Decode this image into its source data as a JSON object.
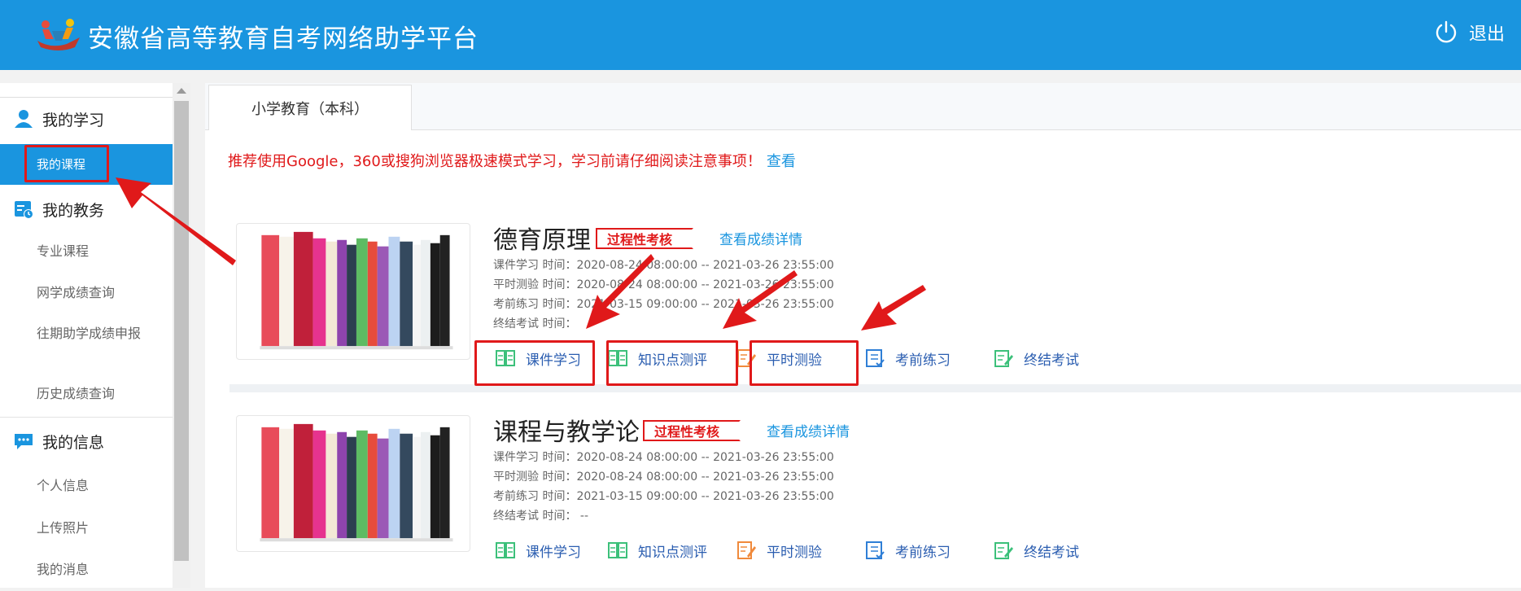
{
  "header": {
    "title": "安徽省高等教育自考网络助学平台",
    "logout": "退出"
  },
  "sidebar": {
    "study": {
      "label": "我的学习",
      "items": [
        {
          "label": "我的课程"
        }
      ]
    },
    "affairs": {
      "label": "我的教务",
      "items": [
        {
          "label": "专业课程"
        },
        {
          "label": "网学成绩查询"
        },
        {
          "label": "往期助学成绩申报"
        },
        {
          "label": "历史成绩查询"
        }
      ]
    },
    "info": {
      "label": "我的信息",
      "items": [
        {
          "label": "个人信息"
        },
        {
          "label": "上传照片"
        },
        {
          "label": "我的消息"
        }
      ]
    }
  },
  "main": {
    "tab": "小学教育（本科）",
    "notice": "推荐使用Google，360或搜狗浏览器极速模式学习，学习前请仔细阅读注意事项！",
    "notice_link": "查看",
    "courses": [
      {
        "title": "德育原理",
        "badge": "过程性考核",
        "detail": "查看成绩详情",
        "times": [
          "课件学习 时间：2020-08-24 08:00:00   --   2021-03-26 23:55:00",
          "平时测验 时间：2020-08-24 08:00:00   --   2021-03-26 23:55:00",
          "考前练习 时间：2021-03-15 09:00:00   --   2021-03-26 23:55:00",
          "终结考试 时间："
        ],
        "actions": [
          "课件学习",
          "知识点测评",
          "平时测验",
          "考前练习",
          "终结考试"
        ]
      },
      {
        "title": "课程与教学论",
        "badge": "过程性考核",
        "detail": "查看成绩详情",
        "times": [
          "课件学习 时间：2020-08-24 08:00:00   --   2021-03-26 23:55:00",
          "平时测验 时间：2020-08-24 08:00:00   --   2021-03-26 23:55:00",
          "考前练习 时间：2021-03-15 09:00:00   --   2021-03-26 23:55:00",
          "终结考试 时间：   --"
        ],
        "actions": [
          "课件学习",
          "知识点测评",
          "平时测验",
          "考前练习",
          "终结考试"
        ]
      }
    ]
  },
  "colors": {
    "primary": "#1a95df",
    "annotation": "#e0191a"
  }
}
